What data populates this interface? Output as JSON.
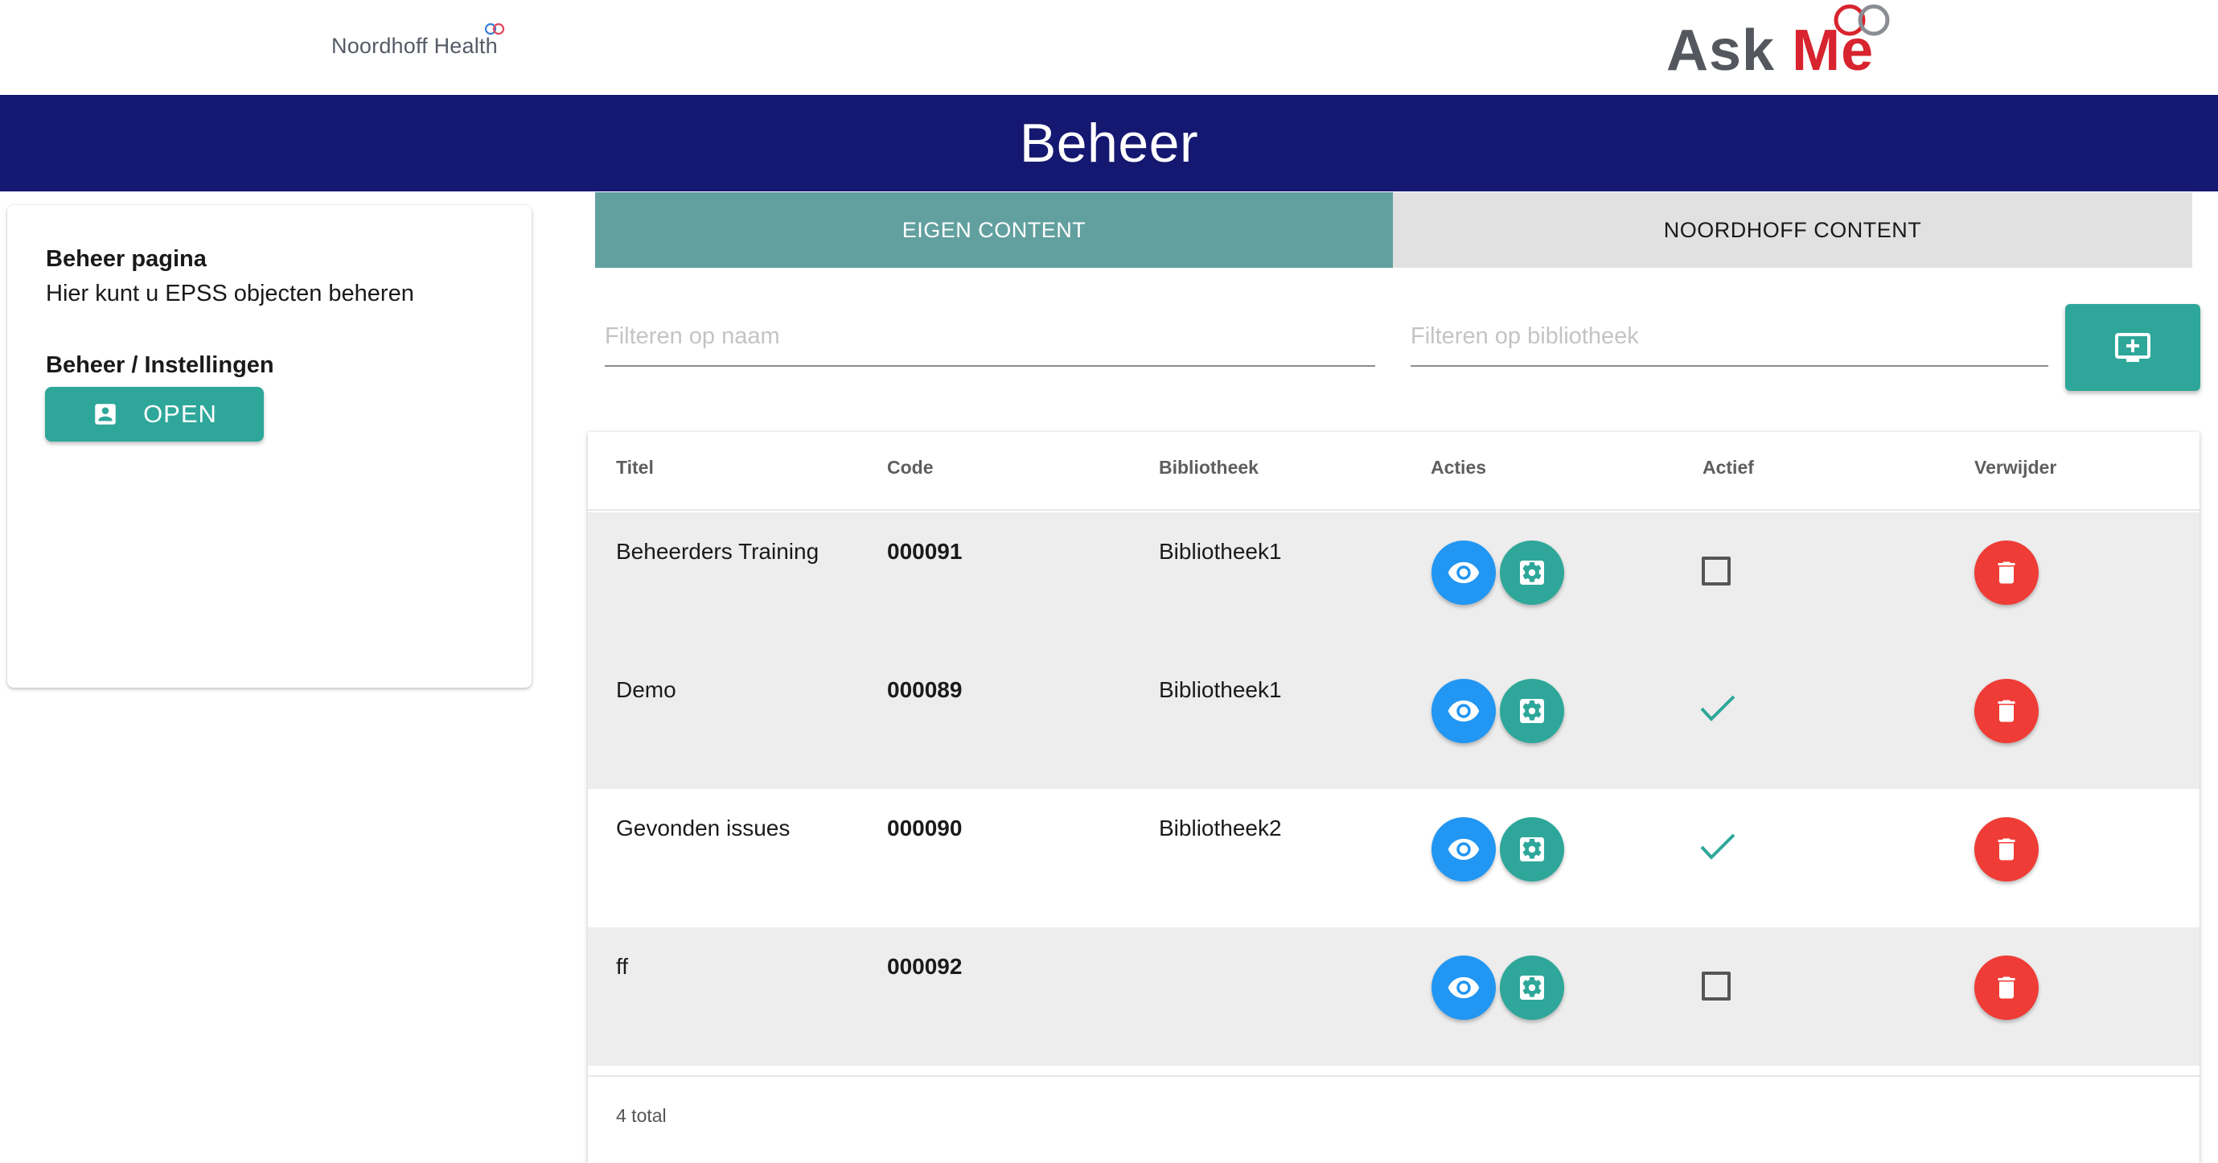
{
  "header": {
    "left_logo_text": "Noordhoff Health",
    "right_logo_ask": "Ask",
    "right_logo_me": "Me",
    "page_title": "Beheer"
  },
  "sidebar": {
    "heading1": "Beheer pagina",
    "description": "Hier kunt u EPSS objecten beheren",
    "heading2": "Beheer / Instellingen",
    "open_label": "OPEN"
  },
  "tabs": [
    {
      "label": "EIGEN CONTENT",
      "active": true
    },
    {
      "label": "NOORDHOFF CONTENT",
      "active": false
    }
  ],
  "filters": {
    "naam_placeholder": "Filteren op naam",
    "bibliotheek_placeholder": "Filteren op bibliotheek"
  },
  "table": {
    "columns": [
      "Titel",
      "Code",
      "Bibliotheek",
      "Acties",
      "Actief",
      "Verwijder"
    ],
    "rows": [
      {
        "titel": "Beheerders Training",
        "code": "000091",
        "bibliotheek": "Bibliotheek1",
        "actief": false
      },
      {
        "titel": "Demo",
        "code": "000089",
        "bibliotheek": "Bibliotheek1",
        "actief": true
      },
      {
        "titel": "Gevonden issues",
        "code": "000090",
        "bibliotheek": "Bibliotheek2",
        "actief": true
      },
      {
        "titel": "ff",
        "code": "000092",
        "bibliotheek": "",
        "actief": false
      }
    ],
    "footer": "4 total"
  },
  "colors": {
    "navy": "#151870",
    "teal": "#2ea79a",
    "tab_active": "#62a09f",
    "blue": "#2196f3",
    "red": "#ef3c36",
    "askme_red": "#d7242e"
  },
  "icons": [
    "account-box-icon",
    "add-to-screen-icon",
    "eye-icon",
    "settings-gear-icon",
    "trash-icon",
    "check-icon"
  ]
}
